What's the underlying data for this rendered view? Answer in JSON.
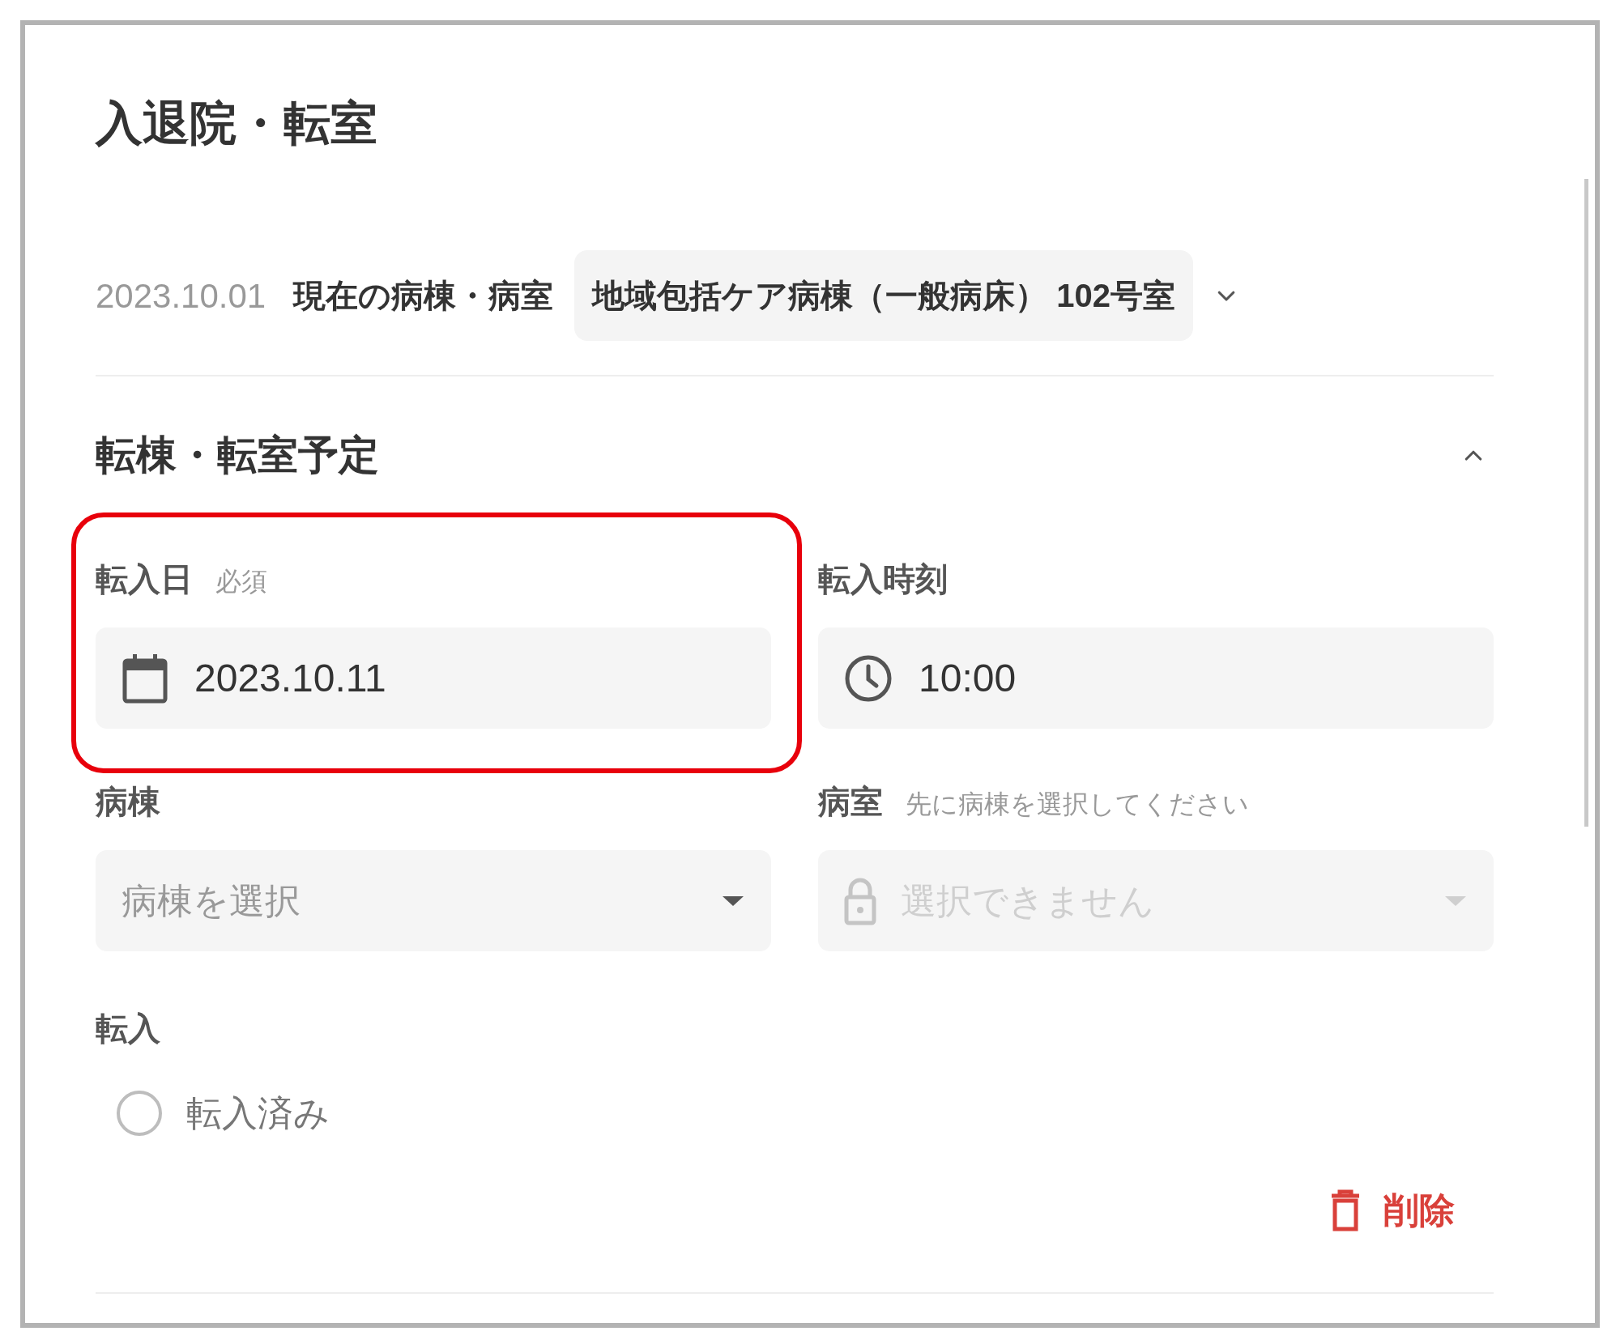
{
  "title": "入退院・転室",
  "current": {
    "date": "2023.10.01",
    "label": "現在の病棟・病室",
    "value": "地域包括ケア病棟（一般病床） 102号室",
    "expanded": false
  },
  "section": {
    "title": "転棟・転室予定",
    "expanded": true
  },
  "fields": [
    {
      "kind": "date",
      "label": "転入日",
      "note": "必須",
      "value": "2023.10.11",
      "highlighted": true
    },
    {
      "kind": "time",
      "label": "転入時刻",
      "value": "10:00",
      "highlighted": false
    },
    {
      "kind": "select",
      "label": "病棟",
      "placeholder": "病棟を選択",
      "disabled": false
    },
    {
      "kind": "select",
      "label": "病室",
      "note": "先に病棟を選択してください",
      "placeholder": "選択できません",
      "disabled": true
    }
  ],
  "move_in": {
    "label": "転入",
    "options": [
      {
        "label": "転入済み",
        "selected": false
      }
    ]
  },
  "delete_button": "削除"
}
